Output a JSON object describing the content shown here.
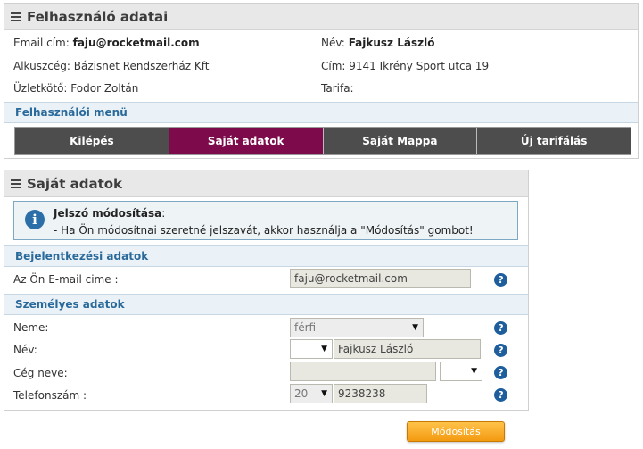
{
  "user_panel": {
    "title": "Felhasználó adatai",
    "email_label": "Email cím:",
    "email_value": "faju@rocketmail.com",
    "name_label": "Név:",
    "name_value": "Fajkusz László",
    "broker_label": "Alkuszcég:",
    "broker_value": "Bázisnet Rendszerház Kft",
    "address_label": "Cím:",
    "address_value": "9141 Ikrény Sport utca 19",
    "agent_label": "Üzletkötő:",
    "agent_value": "Fodor Zoltán",
    "tariff_label": "Tarifa:",
    "tariff_value": ""
  },
  "user_menu": {
    "title": "Felhasználói menü",
    "items": [
      "Kilépés",
      "Saját adatok",
      "Saját Mappa",
      "Új tarifálás"
    ],
    "active_index": 1
  },
  "own_data": {
    "title": "Saját adatok",
    "notice_title": "Jelszó módosítása",
    "notice_text": "- Ha Ön módosítnai szeretné jelszavát, akkor használja a \"Módosítás\" gombot!",
    "login_section": "Bejelentkezési adatok",
    "email_label": "Az Ön E-mail cime :",
    "email_value": "faju@rocketmail.com",
    "personal_section": "Személyes adatok",
    "gender_label": "Neme:",
    "gender_value": "férfi",
    "name_label": "Név:",
    "name_prefix_value": "",
    "name_value": "Fajkusz László",
    "company_label": "Cég neve:",
    "company_value": "",
    "company_type_value": "",
    "phone_label": "Telefonszám :",
    "phone_area_value": "20",
    "phone_value": "9238238"
  },
  "submit_label": "Módosítás",
  "icons": {
    "help": "?",
    "info": "i",
    "dropdown": "▼"
  },
  "colors": {
    "active_menu": "#7d0a4a",
    "menu": "#4d4d4d",
    "section_text": "#2a6a9b",
    "submit": "#f39a10"
  }
}
